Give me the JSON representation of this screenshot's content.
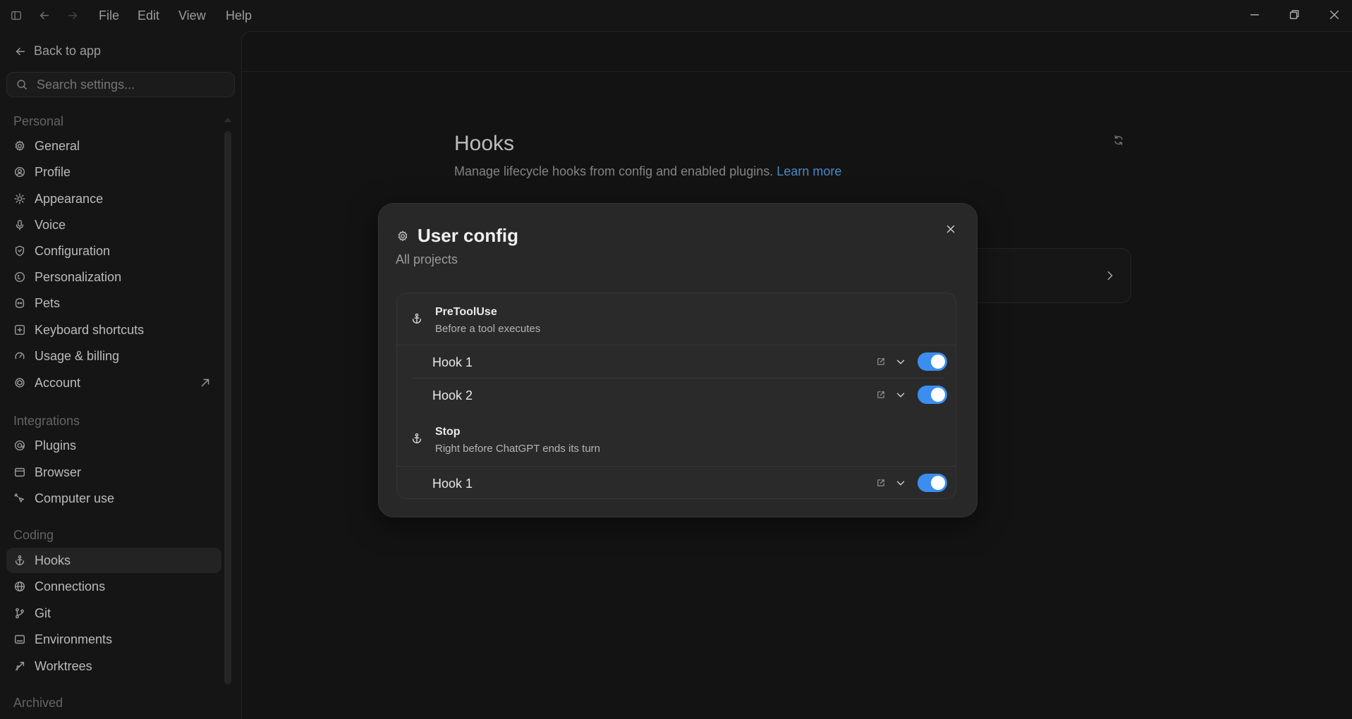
{
  "menu": {
    "file": "File",
    "edit": "Edit",
    "view": "View",
    "help": "Help"
  },
  "sidebar": {
    "back_label": "Back to app",
    "search_placeholder": "Search settings...",
    "sections": {
      "personal": "Personal",
      "integrations": "Integrations",
      "coding": "Coding",
      "archived": "Archived"
    },
    "personal_items": [
      {
        "label": "General",
        "icon": "gear-icon"
      },
      {
        "label": "Profile",
        "icon": "user-circle-icon"
      },
      {
        "label": "Appearance",
        "icon": "sun-icon"
      },
      {
        "label": "Voice",
        "icon": "microphone-icon"
      },
      {
        "label": "Configuration",
        "icon": "shield-icon"
      },
      {
        "label": "Personalization",
        "icon": "personalization-icon"
      },
      {
        "label": "Pets",
        "icon": "pet-icon"
      },
      {
        "label": "Keyboard shortcuts",
        "icon": "keyboard-icon"
      },
      {
        "label": "Usage & billing",
        "icon": "gauge-icon"
      },
      {
        "label": "Account",
        "icon": "account-icon"
      }
    ],
    "integration_items": [
      {
        "label": "Plugins",
        "icon": "plugin-icon"
      },
      {
        "label": "Browser",
        "icon": "browser-icon"
      },
      {
        "label": "Computer use",
        "icon": "computer-use-icon"
      }
    ],
    "coding_items": [
      {
        "label": "Hooks",
        "icon": "anchor-icon",
        "active": true
      },
      {
        "label": "Connections",
        "icon": "globe-icon"
      },
      {
        "label": "Git",
        "icon": "git-branch-icon"
      },
      {
        "label": "Environments",
        "icon": "environment-icon"
      },
      {
        "label": "Worktrees",
        "icon": "worktree-icon"
      }
    ]
  },
  "main": {
    "title": "Hooks",
    "description": "Manage lifecycle hooks from config and enabled plugins.",
    "learn_more": "Learn more"
  },
  "modal": {
    "title": "User config",
    "subtitle": "All projects",
    "groups": [
      {
        "name": "PreToolUse",
        "description": "Before a tool executes",
        "hooks": [
          {
            "name": "Hook 1",
            "enabled": true
          },
          {
            "name": "Hook 2",
            "enabled": true
          }
        ]
      },
      {
        "name": "Stop",
        "description": "Right before ChatGPT ends its turn",
        "hooks": [
          {
            "name": "Hook 1",
            "enabled": true
          }
        ]
      }
    ]
  },
  "colors": {
    "accent": "#3b8ef0",
    "link": "#5aa6f2",
    "background": "#1a1a1a",
    "modal": "#282828"
  }
}
